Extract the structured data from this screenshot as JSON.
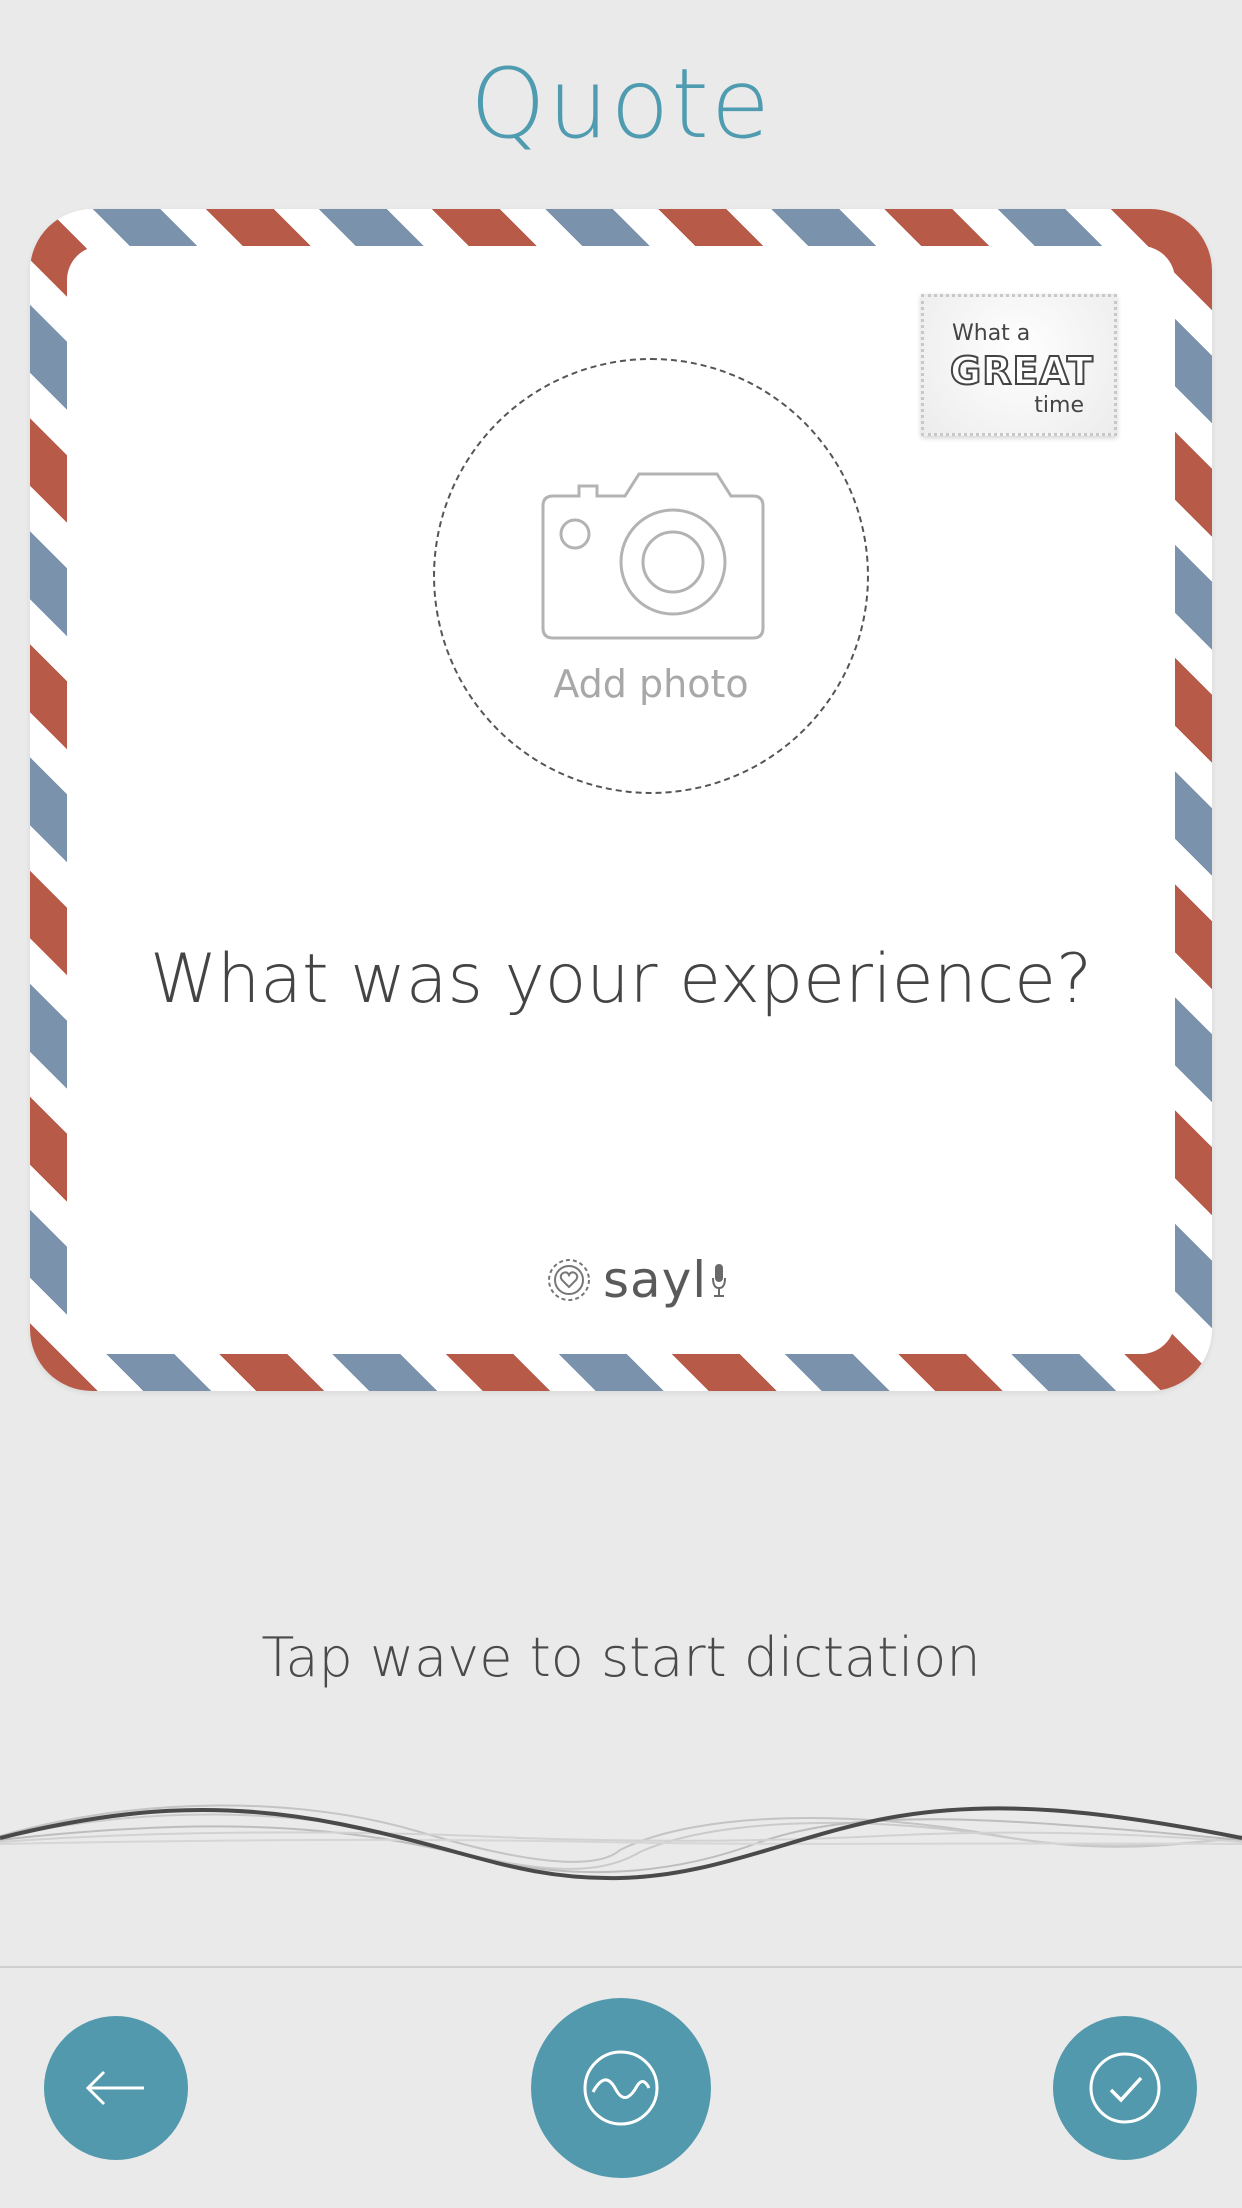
{
  "header": {
    "title": "Quote"
  },
  "card": {
    "stamp": {
      "line1": "What a",
      "line2": "GREAT",
      "line3": "time"
    },
    "photo": {
      "label": "Add photo",
      "icon": "camera-icon"
    },
    "prompt": "What was your experience?",
    "brand": {
      "name": "sayl",
      "badge_icon": "heart-badge-icon",
      "mic_icon": "microphone-icon"
    }
  },
  "dictation": {
    "hint": "Tap wave to start dictation"
  },
  "bottom_bar": {
    "back_icon": "arrow-left-icon",
    "record_icon": "wave-icon",
    "done_icon": "check-icon"
  },
  "colors": {
    "accent": "#5299ad",
    "title": "#4f9bb0",
    "stripe_red": "#b85a48",
    "stripe_blue": "#7a92ab",
    "background": "#eaeaea"
  }
}
